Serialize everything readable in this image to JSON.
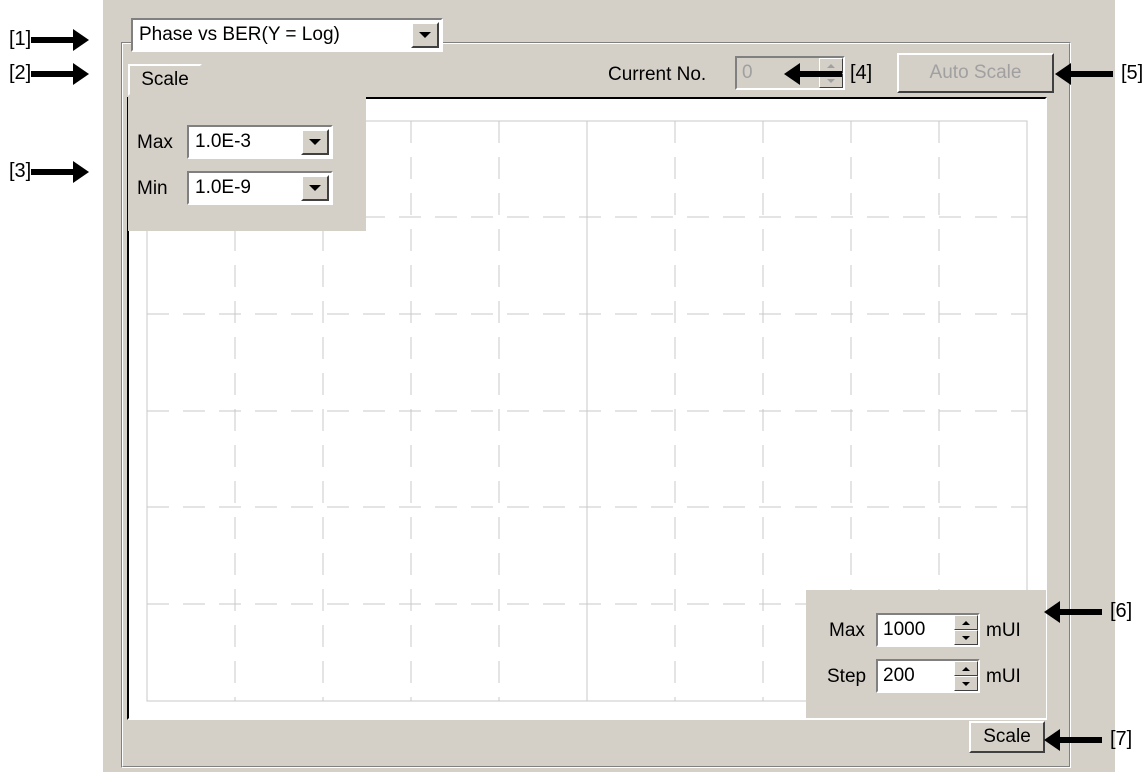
{
  "graph_type": {
    "value": "Phase vs BER(Y = Log)"
  },
  "y_scale": {
    "button_label": "Scale",
    "max_label": "Max",
    "max_value": "1.0E-3",
    "min_label": "Min",
    "min_value": "1.0E-9"
  },
  "current_no": {
    "label": "Current No.",
    "value": "0"
  },
  "auto_scale": {
    "label": "Auto Scale"
  },
  "x_scale": {
    "max_label": "Max",
    "max_value": "1000",
    "max_unit": "mUI",
    "step_label": "Step",
    "step_value": "200",
    "step_unit": "mUI",
    "button_label": "Scale"
  },
  "callouts": {
    "c1": "[1]",
    "c2": "[2]",
    "c3": "[3]",
    "c4": "[4]",
    "c5": "[5]",
    "c6": "[6]",
    "c7": "[7]"
  }
}
